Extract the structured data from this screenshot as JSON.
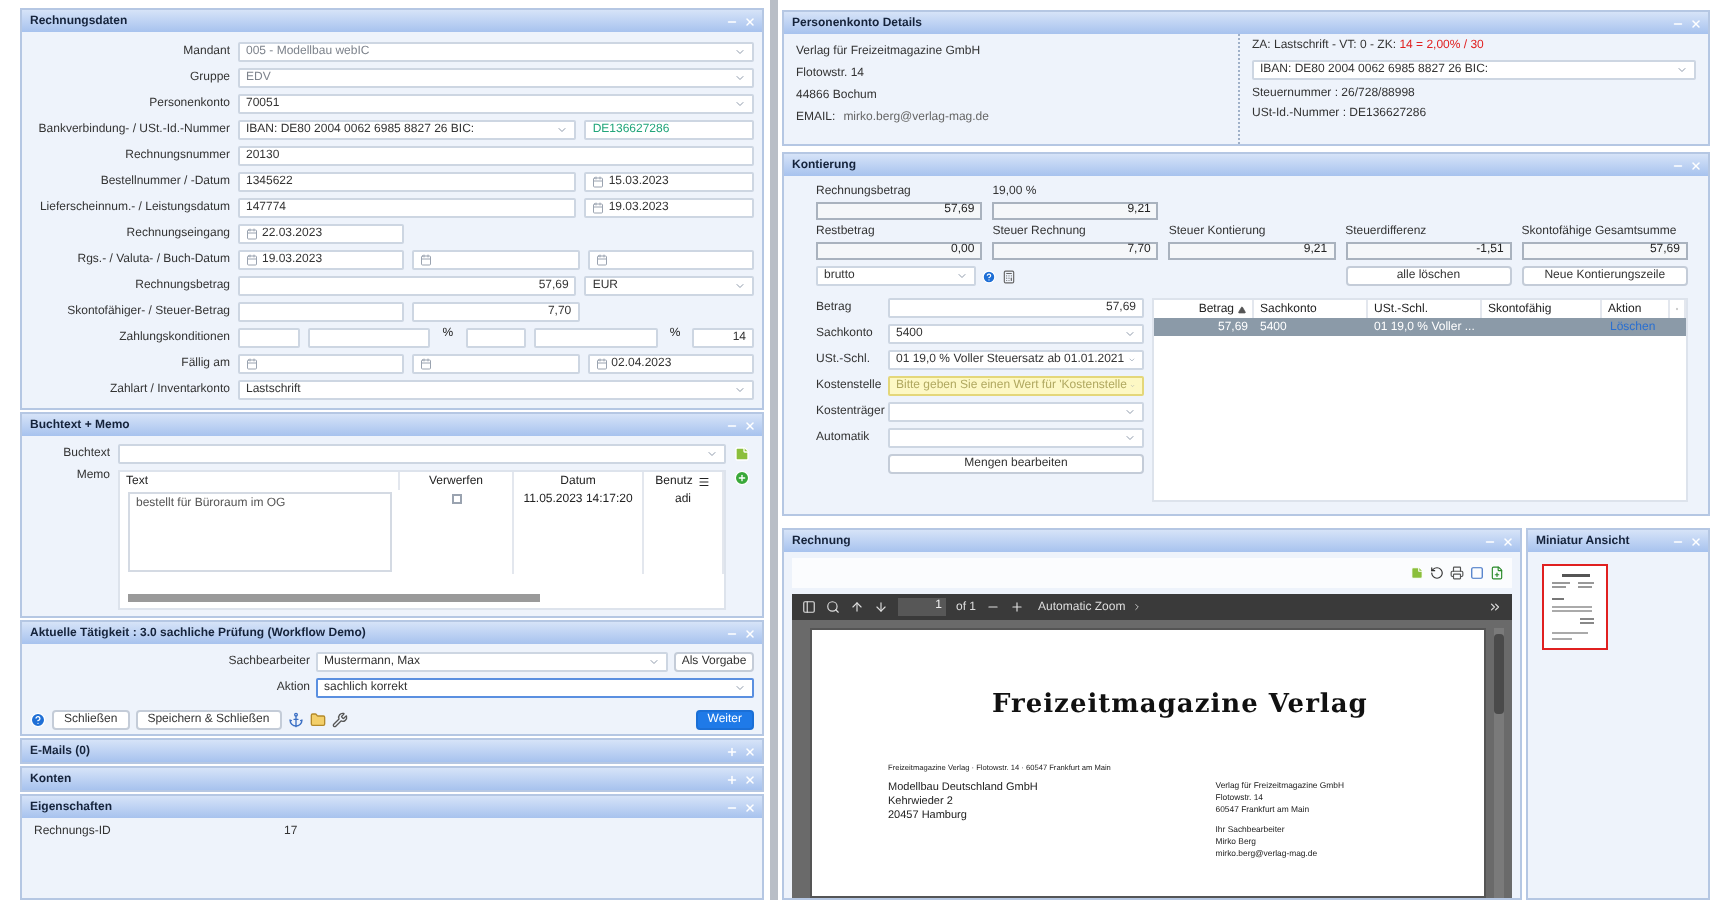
{
  "rechnungsdaten": {
    "title": "Rechnungsdaten",
    "expanded": true,
    "rows": [
      {
        "label": "Mandant",
        "kind": "full",
        "fields": [
          {
            "kind": "select",
            "value": "005 - Modellbau webIC",
            "disabled": true
          }
        ]
      },
      {
        "label": "Gruppe",
        "kind": "full",
        "fields": [
          {
            "kind": "select",
            "value": "EDV",
            "disabled": true
          }
        ]
      },
      {
        "label": "Personenkonto",
        "kind": "full",
        "fields": [
          {
            "kind": "select",
            "value": "70051"
          }
        ]
      },
      {
        "label": "Bankverbindung- / USt.-Id.-Nummer",
        "kind": "split",
        "fields": [
          {
            "kind": "select",
            "value": "IBAN: DE80 2004 0062 6985 8827 26   BIC:"
          },
          {
            "kind": "input",
            "value": "DE136627286",
            "valid": true
          }
        ]
      },
      {
        "label": "Rechnungsnummer",
        "kind": "full",
        "fields": [
          {
            "kind": "input",
            "value": "20130"
          }
        ]
      },
      {
        "label": "Bestellnummer / -Datum",
        "kind": "split",
        "fields": [
          {
            "kind": "input",
            "value": "1345622"
          },
          {
            "kind": "date",
            "value": "15.03.2023"
          }
        ]
      },
      {
        "label": "Lieferscheinnum.- / Leistungsdatum",
        "kind": "split",
        "fields": [
          {
            "kind": "input",
            "value": "147774"
          },
          {
            "kind": "date",
            "value": "19.03.2023"
          }
        ]
      },
      {
        "label": "Rechnungseingang",
        "kind": "thirds",
        "fields": [
          {
            "kind": "date",
            "value": "22.03.2023"
          }
        ]
      },
      {
        "label": "Rgs.- / Valuta- / Buch-Datum",
        "kind": "thirds",
        "fields": [
          {
            "kind": "date",
            "value": "19.03.2023"
          },
          {
            "kind": "date"
          },
          {
            "kind": "date"
          }
        ]
      },
      {
        "label": "Rechnungsbetrag",
        "kind": "split",
        "fields": [
          {
            "kind": "number",
            "value": "57,69"
          },
          {
            "kind": "select",
            "value": "EUR"
          }
        ]
      },
      {
        "label": "Skontofähiger- / Steuer-Betrag",
        "kind": "thirds",
        "fields": [
          {
            "kind": "number"
          },
          {
            "kind": "number",
            "value": "7,70"
          }
        ]
      },
      {
        "label": "Zahlungskonditionen",
        "kind": "terms",
        "fields": [
          {
            "kind": "number"
          },
          {
            "kind": "number"
          },
          {
            "kind": "unit",
            "value": "%"
          },
          {
            "kind": "number"
          },
          {
            "kind": "number"
          },
          {
            "kind": "unit",
            "value": "%"
          },
          {
            "kind": "number",
            "value": "14"
          }
        ]
      },
      {
        "label": "Fällig am",
        "kind": "thirds",
        "fields": [
          {
            "kind": "date"
          },
          {
            "kind": "date"
          },
          {
            "kind": "date",
            "value": "02.04.2023"
          }
        ]
      },
      {
        "label": "Zahlart / Inventarkonto",
        "kind": "full",
        "fields": [
          {
            "kind": "select",
            "value": "Lastschrift"
          }
        ]
      }
    ]
  },
  "memo": {
    "title": "Buchtext + Memo",
    "expanded": true,
    "buchtext_label": "Buchtext",
    "memo_label": "Memo",
    "columns": [
      "Text",
      "Verwerfen",
      "Datum",
      "Benutz"
    ],
    "rows": [
      {
        "text": "bestellt für Büroraum im OG",
        "discarded": false,
        "date": "11.05.2023 14:17:20",
        "user": "adi"
      }
    ]
  },
  "activity": {
    "title": "Aktuelle Tätigkeit : 3.0 sachliche Prüfung (Workflow Demo)",
    "expanded": true,
    "clerk_label": "Sachbearbeiter",
    "clerk": "Mustermann, Max",
    "clerk_button": "Als Vorgabe",
    "action_label": "Aktion",
    "action": "sachlich korrekt",
    "action_focused": true,
    "buttons": [
      "Schließen",
      "Speichern & Schließen"
    ],
    "next": "Weiter"
  },
  "sections": [
    {
      "title": "E-Mails (0)",
      "expanded": false
    },
    {
      "title": "Konten",
      "expanded": false
    },
    {
      "title": "Eigenschaften",
      "expanded": true,
      "properties": [
        {
          "label": "Rechnungs-ID",
          "value": "17"
        }
      ]
    }
  ],
  "account": {
    "title": "Personenkonto Details",
    "expanded": true,
    "address": [
      "Verlag für Freizeitmagazine GmbH",
      "Flotowstr. 14",
      "44866 Bochum"
    ],
    "email_label": "EMAIL:",
    "email": "mirko.berg@verlag-mag.de",
    "terms": "ZA: Lastschrift - VT: 0 - ZK:",
    "terms_highlight": "14 = 2,00% / 30",
    "iban": "IBAN: DE80 2004 0062 6985 8827 26   BIC:",
    "tax_number": "Steuernummer : 26/728/88998",
    "vat_id": "USt-Id.-Nummer : DE136627286"
  },
  "kontierung": {
    "title": "Kontierung",
    "expanded": true,
    "totals": [
      {
        "items": [
          {
            "label": "Rechnungsbetrag",
            "value": "57,69"
          },
          {
            "label": "19,00 %",
            "value": "9,21"
          }
        ]
      },
      {
        "items": [
          {
            "label": "Restbetrag",
            "value": "0,00"
          },
          {
            "label": "Steuer Rechnung",
            "value": "7,70"
          },
          {
            "label": "Steuer Kontierung",
            "value": "9,21"
          },
          {
            "label": "Steuerdifferenz",
            "value": "-1,51"
          },
          {
            "label": "Skontofähige Gesamtsumme",
            "value": "57,69"
          }
        ]
      }
    ],
    "mode": "brutto",
    "buttons": [
      "alle löschen",
      "Neue Kontierungszeile"
    ],
    "form": [
      {
        "label": "Betrag",
        "kind": "number",
        "value": "57,69"
      },
      {
        "label": "Sachkonto",
        "kind": "select",
        "value": "5400"
      },
      {
        "label": "USt.-Schl.",
        "kind": "select",
        "value": "01 19,0 % Voller Steuersatz ab 01.01.2021"
      },
      {
        "label": "Kostenstelle",
        "kind": "select",
        "placeholder": "Bitte geben Sie einen Wert für 'Kostenstelle",
        "invalid": true
      },
      {
        "label": "Kostenträger",
        "kind": "select"
      },
      {
        "label": "Automatik",
        "kind": "select"
      }
    ],
    "edit_button": "Mengen bearbeiten",
    "columns": [
      {
        "label": "Betrag",
        "sorted": true
      },
      {
        "label": "Sachkonto",
        "sorted": false
      },
      {
        "label": "USt.-Schl.",
        "sorted": false
      },
      {
        "label": "Skontofähig",
        "sorted": false
      },
      {
        "label": "Aktion",
        "sorted": false
      }
    ],
    "rows": [
      {
        "selected": true,
        "amount": "57,69",
        "account": "5400",
        "tax_key": "01 19,0 % Voller ...",
        "action": "Löschen"
      }
    ]
  },
  "rechnung": {
    "title": "Rechnung",
    "expanded": true,
    "page": "1",
    "page_count": "of 1",
    "zoom": "Automatic Zoom",
    "document": {
      "heading": "Freizeitmagazine Verlag",
      "sender_line": "Freizeitmagazine Verlag · Flotowstr. 14 · 60547 Frankfurt am Main",
      "recipient": [
        "Modellbau Deutschland GmbH",
        "Kehrwieder 2",
        "20457 Hamburg"
      ],
      "contact": [
        "Verlag für Freizeitmagazine GmbH",
        "Flotowstr. 14",
        "60547 Frankfurt am Main"
      ],
      "clerk": [
        "Ihr Sachbearbeiter",
        "Mirko Berg",
        "mirko.berg@verlag-mag.de"
      ]
    }
  },
  "thumbnails": {
    "title": "Miniatur Ansicht",
    "expanded": true,
    "pages": [
      {
        "selected": true
      }
    ]
  }
}
